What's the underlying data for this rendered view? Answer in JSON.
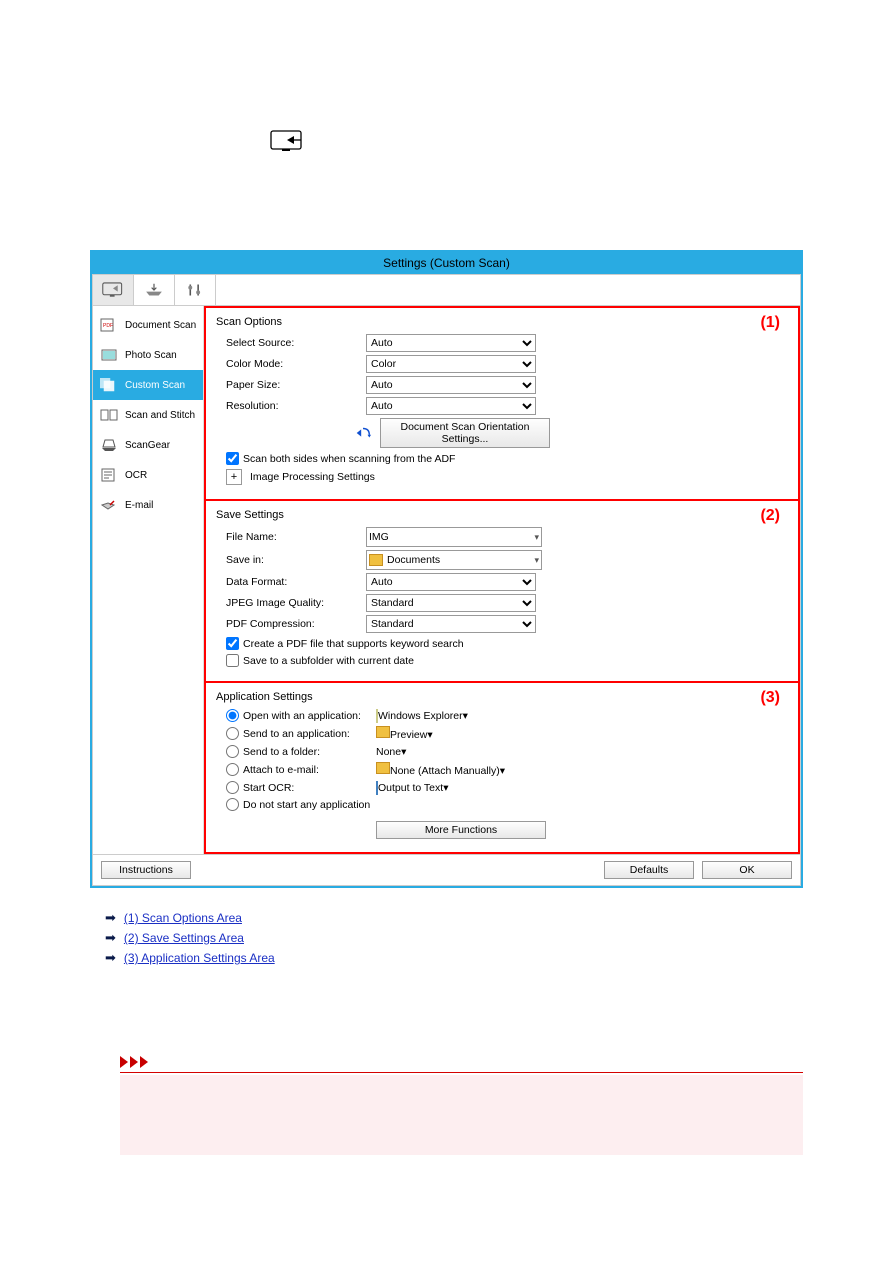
{
  "dialog": {
    "title": "Settings (Custom Scan)"
  },
  "sidebar": {
    "items": [
      {
        "label": "Document Scan"
      },
      {
        "label": "Photo Scan"
      },
      {
        "label": "Custom Scan"
      },
      {
        "label": "Scan and Stitch"
      },
      {
        "label": "ScanGear"
      },
      {
        "label": "OCR"
      },
      {
        "label": "E-mail"
      }
    ]
  },
  "scan_options": {
    "title": "Scan Options",
    "select_source_label": "Select Source:",
    "select_source_value": "Auto",
    "color_mode_label": "Color Mode:",
    "color_mode_value": "Color",
    "paper_size_label": "Paper Size:",
    "paper_size_value": "Auto",
    "resolution_label": "Resolution:",
    "resolution_value": "Auto",
    "orient_button": "Document Scan Orientation Settings...",
    "both_sides_label": "Scan both sides when scanning from the ADF",
    "img_proc_label": "Image Processing Settings",
    "num": "(1)"
  },
  "save_settings": {
    "title": "Save Settings",
    "file_name_label": "File Name:",
    "file_name_value": "IMG",
    "save_in_label": "Save in:",
    "save_in_value": "Documents",
    "data_format_label": "Data Format:",
    "data_format_value": "Auto",
    "jpeg_label": "JPEG Image Quality:",
    "jpeg_value": "Standard",
    "pdf_label": "PDF Compression:",
    "pdf_value": "Standard",
    "create_pdf_label": "Create a PDF file that supports keyword search",
    "subfolder_label": "Save to a subfolder with current date",
    "num": "(2)"
  },
  "app_settings": {
    "title": "Application Settings",
    "open_with_label": "Open with an application:",
    "open_with_value": "Windows Explorer",
    "send_app_label": "Send to an application:",
    "send_app_value": "Preview",
    "send_folder_label": "Send to a folder:",
    "send_folder_value": "None",
    "attach_label": "Attach to e-mail:",
    "attach_value": "None (Attach Manually)",
    "ocr_label": "Start OCR:",
    "ocr_value": "Output to Text",
    "none_label": "Do not start any application",
    "more_functions": "More Functions",
    "num": "(3)"
  },
  "footer": {
    "instructions": "Instructions",
    "defaults": "Defaults",
    "ok": "OK"
  },
  "links": {
    "l1": "(1) Scan Options Area",
    "l2": "(2) Save Settings Area",
    "l3": "(3) Application Settings Area"
  }
}
